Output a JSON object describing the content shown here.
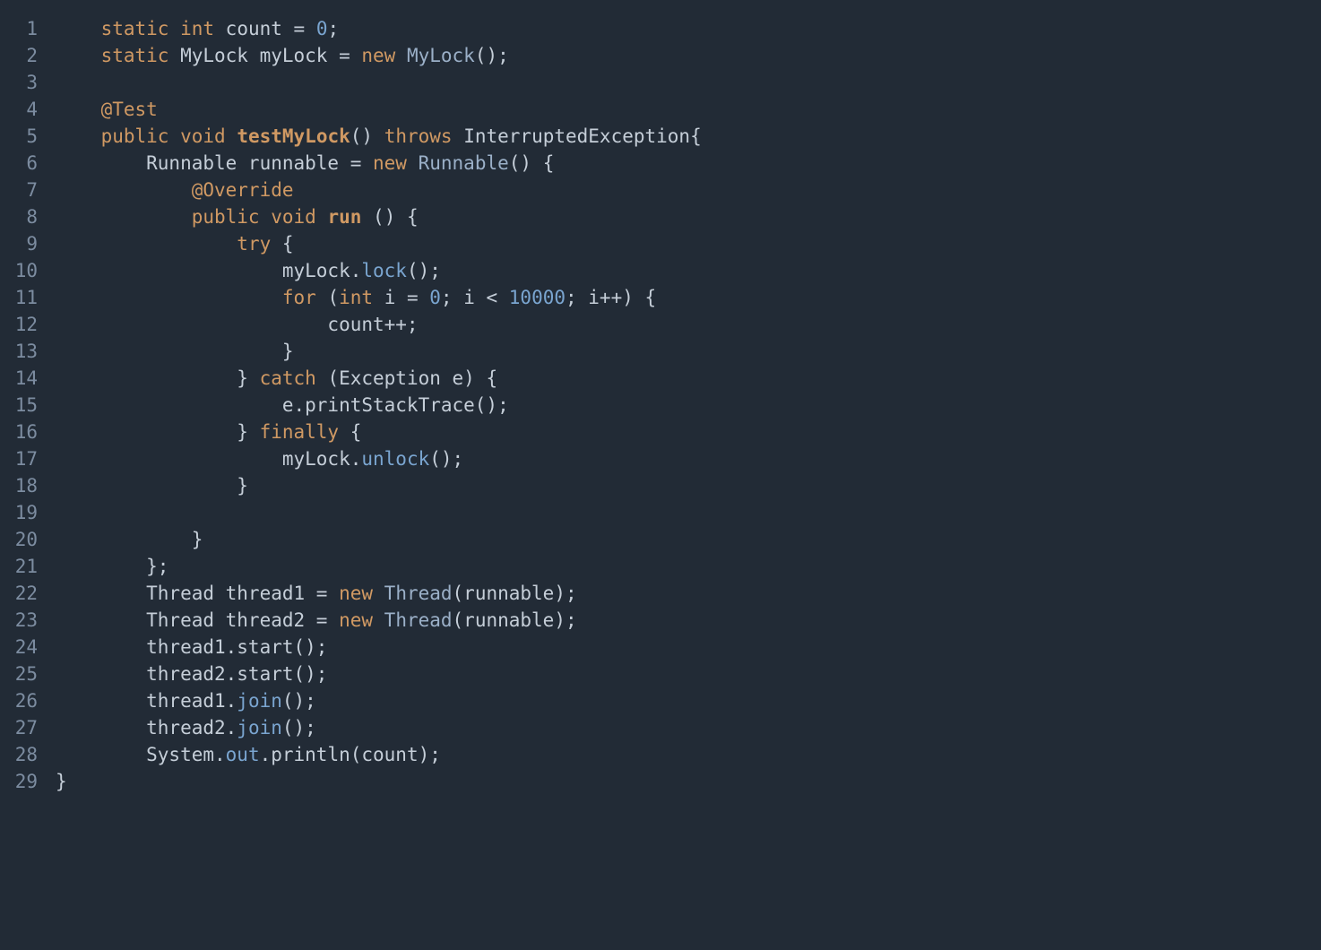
{
  "lineCount": 29,
  "lines": {
    "l1": [
      [
        "    ",
        "punct"
      ],
      [
        "static",
        "kw"
      ],
      [
        " ",
        "punct"
      ],
      [
        "int",
        "kw"
      ],
      [
        " count = ",
        "punct"
      ],
      [
        "0",
        "num"
      ],
      [
        ";",
        "punct"
      ]
    ],
    "l2": [
      [
        "    ",
        "punct"
      ],
      [
        "static",
        "kw"
      ],
      [
        " MyLock myLock = ",
        "punct"
      ],
      [
        "new",
        "kw"
      ],
      [
        " ",
        "punct"
      ],
      [
        "MyLock",
        "type"
      ],
      [
        "();",
        "punct"
      ]
    ],
    "l3": [
      [
        "",
        "punct"
      ]
    ],
    "l4": [
      [
        "    ",
        "punct"
      ],
      [
        "@Test",
        "ann"
      ]
    ],
    "l5": [
      [
        "    ",
        "punct"
      ],
      [
        "public",
        "kw"
      ],
      [
        " ",
        "punct"
      ],
      [
        "void",
        "kw"
      ],
      [
        " ",
        "punct"
      ],
      [
        "testMyLock",
        "fn"
      ],
      [
        "() ",
        "punct"
      ],
      [
        "throws",
        "kw"
      ],
      [
        " InterruptedException{",
        "punct"
      ]
    ],
    "l6": [
      [
        "        Runnable runnable = ",
        "punct"
      ],
      [
        "new",
        "kw"
      ],
      [
        " ",
        "punct"
      ],
      [
        "Runnable",
        "type"
      ],
      [
        "() {",
        "punct"
      ]
    ],
    "l7": [
      [
        "            ",
        "punct"
      ],
      [
        "@Override",
        "ann"
      ]
    ],
    "l8": [
      [
        "            ",
        "punct"
      ],
      [
        "public",
        "kw"
      ],
      [
        " ",
        "punct"
      ],
      [
        "void",
        "kw"
      ],
      [
        " ",
        "punct"
      ],
      [
        "run",
        "fn"
      ],
      [
        " () {",
        "punct"
      ]
    ],
    "l9": [
      [
        "                ",
        "punct"
      ],
      [
        "try",
        "kw"
      ],
      [
        " {",
        "punct"
      ]
    ],
    "l10": [
      [
        "                    myLock.",
        "punct"
      ],
      [
        "lock",
        "mtd"
      ],
      [
        "();",
        "punct"
      ]
    ],
    "l11": [
      [
        "                    ",
        "punct"
      ],
      [
        "for",
        "kw"
      ],
      [
        " (",
        "punct"
      ],
      [
        "int",
        "kw"
      ],
      [
        " i = ",
        "punct"
      ],
      [
        "0",
        "num"
      ],
      [
        "; i < ",
        "punct"
      ],
      [
        "10000",
        "num"
      ],
      [
        "; i++) {",
        "punct"
      ]
    ],
    "l12": [
      [
        "                        count++;",
        "punct"
      ]
    ],
    "l13": [
      [
        "                    }",
        "punct"
      ]
    ],
    "l14": [
      [
        "                } ",
        "punct"
      ],
      [
        "catch",
        "kw"
      ],
      [
        " (Exception e) {",
        "punct"
      ]
    ],
    "l15": [
      [
        "                    e.printStackTrace();",
        "punct"
      ]
    ],
    "l16": [
      [
        "                } ",
        "punct"
      ],
      [
        "finally",
        "kw"
      ],
      [
        " {",
        "punct"
      ]
    ],
    "l17": [
      [
        "                    myLock.",
        "punct"
      ],
      [
        "unlock",
        "mtd"
      ],
      [
        "();",
        "punct"
      ]
    ],
    "l18": [
      [
        "                }",
        "punct"
      ]
    ],
    "l19": [
      [
        "",
        "punct"
      ]
    ],
    "l20": [
      [
        "            }",
        "punct"
      ]
    ],
    "l21": [
      [
        "        };",
        "punct"
      ]
    ],
    "l22": [
      [
        "        Thread thread1 = ",
        "punct"
      ],
      [
        "new",
        "kw"
      ],
      [
        " ",
        "punct"
      ],
      [
        "Thread",
        "type"
      ],
      [
        "(runnable);",
        "punct"
      ]
    ],
    "l23": [
      [
        "        Thread thread2 = ",
        "punct"
      ],
      [
        "new",
        "kw"
      ],
      [
        " ",
        "punct"
      ],
      [
        "Thread",
        "type"
      ],
      [
        "(runnable);",
        "punct"
      ]
    ],
    "l24": [
      [
        "        thread1.start();",
        "punct"
      ]
    ],
    "l25": [
      [
        "        thread2.start();",
        "punct"
      ]
    ],
    "l26": [
      [
        "        thread1.",
        "punct"
      ],
      [
        "join",
        "mtd"
      ],
      [
        "();",
        "punct"
      ]
    ],
    "l27": [
      [
        "        thread2.",
        "punct"
      ],
      [
        "join",
        "mtd"
      ],
      [
        "();",
        "punct"
      ]
    ],
    "l28": [
      [
        "        System.",
        "punct"
      ],
      [
        "out",
        "mtd"
      ],
      [
        ".println(count);",
        "punct"
      ]
    ],
    "l29": [
      [
        "}",
        "punct"
      ]
    ]
  }
}
